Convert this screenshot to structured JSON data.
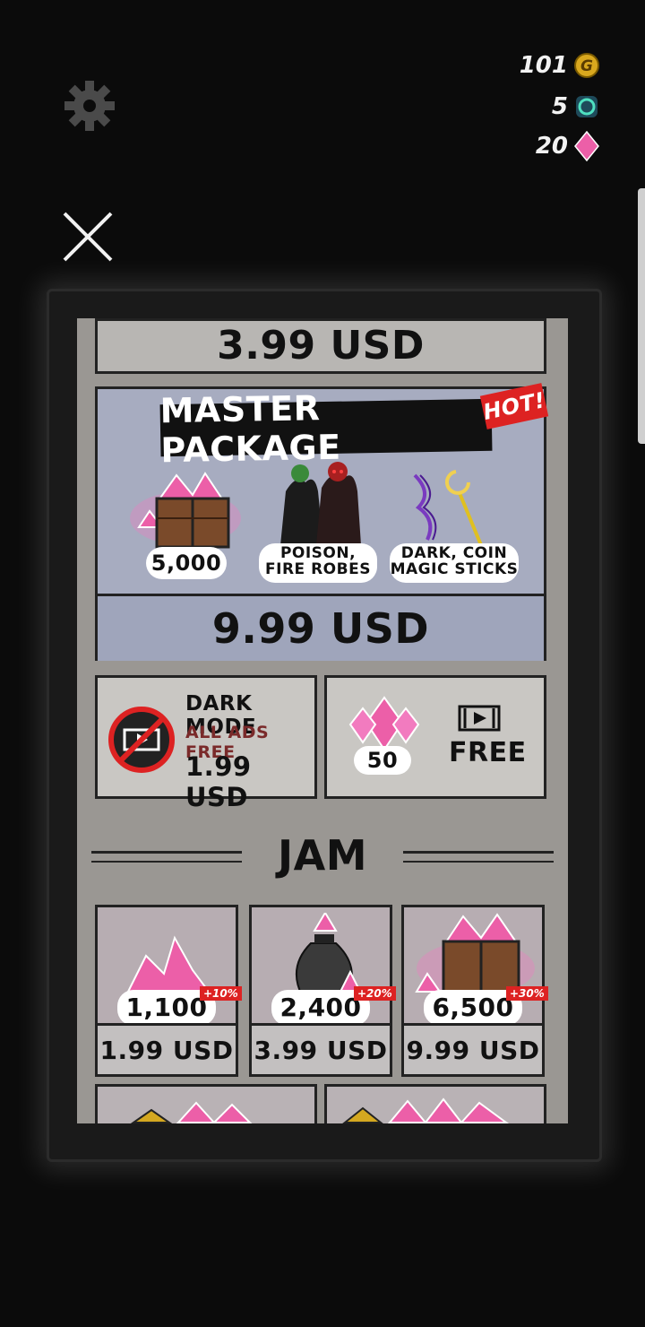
{
  "header": {
    "settings_icon": "gear-icon",
    "currencies": [
      {
        "value": "101",
        "icon": "gold-coin-icon"
      },
      {
        "value": "5",
        "icon": "teal-gem-icon"
      },
      {
        "value": "20",
        "icon": "pink-diamond-icon"
      }
    ],
    "close_icon": "close-icon"
  },
  "shop": {
    "top_price": "3.99 USD",
    "master": {
      "title": "MASTER PACKAGE",
      "badge": "HOT!",
      "gems_amount": "5,000",
      "robes_label": "POISON, FIRE ROBES",
      "sticks_label": "DARK, COIN MAGIC STICKS",
      "price": "9.99 USD"
    },
    "dark_mode": {
      "title": "DARK MODE",
      "subtitle": "ALL ADS FREE",
      "price": "1.99 USD",
      "icon": "no-ads-icon"
    },
    "free_gems": {
      "amount": "50",
      "label": "FREE",
      "icon": "video-ad-icon"
    },
    "jam_title": "JAM",
    "jam_items": [
      {
        "amount": "1,100",
        "bonus": "+10%",
        "price": "1.99 USD"
      },
      {
        "amount": "2,400",
        "bonus": "+20%",
        "price": "3.99 USD"
      },
      {
        "amount": "6,500",
        "bonus": "+30%",
        "price": "9.99 USD"
      }
    ]
  },
  "colors": {
    "background": "#0b0b0b",
    "card": "#c9c7c3",
    "master_card": "#a7acc0",
    "gem_pink": "#ec5fa8",
    "hot_red": "#d22222"
  }
}
